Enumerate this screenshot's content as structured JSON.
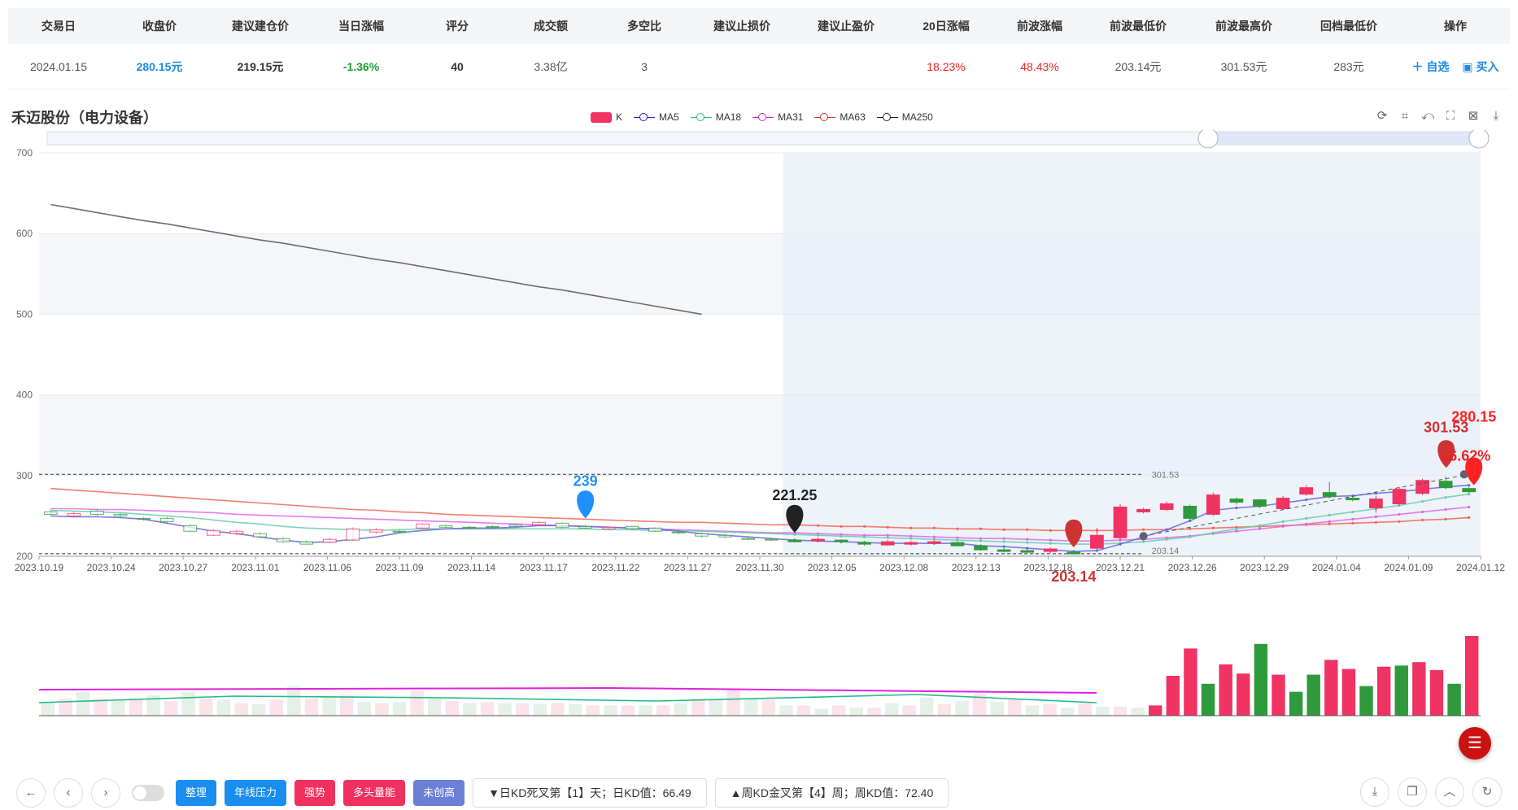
{
  "summary": {
    "headers": [
      "交易日",
      "收盘价",
      "建议建仓价",
      "当日涨幅",
      "评分",
      "成交额",
      "多空比",
      "建议止损价",
      "建议止盈价",
      "20日涨幅",
      "前波涨幅",
      "前波最低价",
      "前波最高价",
      "回档最低价",
      "操作"
    ],
    "row": {
      "date": "2024.01.15",
      "close": "280.15元",
      "entry": "219.15元",
      "change": "-1.36%",
      "score": "40",
      "amount": "3.38亿",
      "ratio": "3",
      "stop_loss": "",
      "take_profit": "",
      "chg20": "18.23%",
      "prev_wave_chg": "48.43%",
      "prev_low": "203.14元",
      "prev_high": "301.53元",
      "pullback_low": "283元"
    },
    "ops": [
      "＋ 自选",
      "▣ 买入"
    ]
  },
  "chart": {
    "title": "禾迈股份（电力设备）",
    "legend": [
      {
        "name": "K",
        "color": "#f03363"
      },
      {
        "name": "MA5",
        "color": "#2222cc"
      },
      {
        "name": "MA18",
        "color": "#22bb88"
      },
      {
        "name": "MA31",
        "color": "#dd22dd"
      },
      {
        "name": "MA63",
        "color": "#dd3333"
      },
      {
        "name": "MA250",
        "color": "#222222"
      }
    ]
  },
  "chart_data": {
    "type": "candlestick",
    "ylim": [
      200,
      700
    ],
    "yticks": [
      200,
      300,
      400,
      500,
      600,
      700
    ],
    "xtick_labels": [
      "2023.10.19",
      "2023.10.24",
      "2023.10.27",
      "2023.11.01",
      "2023.11.06",
      "2023.11.09",
      "2023.11.14",
      "2023.11.17",
      "2023.11.22",
      "2023.11.27",
      "2023.11.30",
      "2023.12.05",
      "2023.12.08",
      "2023.12.13",
      "2023.12.18",
      "2023.12.21",
      "2023.12.26",
      "2023.12.29",
      "2024.01.04",
      "2024.01.09",
      "2024.01.12"
    ],
    "candles": [
      [
        255,
        252,
        258,
        251
      ],
      [
        250,
        253,
        256,
        248
      ],
      [
        256,
        252,
        259,
        250
      ],
      [
        252,
        250,
        254,
        247
      ],
      [
        247,
        246,
        249,
        244
      ],
      [
        247,
        243,
        249,
        240
      ],
      [
        238,
        231,
        240,
        230
      ],
      [
        226,
        232,
        234,
        225
      ],
      [
        228,
        231,
        233,
        226
      ],
      [
        228,
        224,
        230,
        222
      ],
      [
        222,
        218,
        224,
        216
      ],
      [
        218,
        215,
        220,
        214
      ],
      [
        217,
        221,
        223,
        216
      ],
      [
        220,
        234,
        236,
        219
      ],
      [
        230,
        233,
        235,
        228
      ],
      [
        231,
        230,
        233,
        229
      ],
      [
        235,
        240,
        241,
        234
      ],
      [
        238,
        236,
        240,
        235
      ],
      [
        236,
        235,
        238,
        234
      ],
      [
        237,
        236,
        239,
        235
      ],
      [
        239,
        237,
        241,
        236
      ],
      [
        239,
        242,
        243,
        238
      ],
      [
        241,
        236,
        242,
        234
      ],
      [
        237,
        235,
        239,
        234
      ],
      [
        234,
        236,
        237,
        233
      ],
      [
        237,
        234,
        238,
        233
      ],
      [
        235,
        231,
        236,
        230
      ],
      [
        230,
        229,
        232,
        227
      ],
      [
        228,
        225,
        230,
        223
      ],
      [
        226,
        224,
        228,
        222
      ],
      [
        222,
        221,
        224,
        220
      ],
      [
        221,
        220,
        223,
        219
      ],
      [
        220,
        218,
        222,
        217
      ],
      [
        219,
        221,
        223,
        218
      ],
      [
        220,
        218,
        221,
        216
      ],
      [
        217,
        215,
        219,
        213
      ],
      [
        214,
        218,
        220,
        213
      ],
      [
        215,
        217,
        219,
        213
      ],
      [
        216,
        218,
        220,
        215
      ],
      [
        217,
        213,
        218,
        212
      ],
      [
        213,
        208,
        214,
        207
      ],
      [
        208,
        206,
        210,
        205
      ],
      [
        207,
        205,
        209,
        204
      ],
      [
        206,
        209,
        211,
        204
      ],
      [
        205,
        203,
        207,
        202
      ],
      [
        210,
        226,
        235,
        208
      ],
      [
        223,
        261,
        265,
        220
      ],
      [
        255,
        258,
        260,
        253
      ],
      [
        258,
        265,
        268,
        256
      ],
      [
        262,
        247,
        264,
        245
      ],
      [
        252,
        276,
        279,
        250
      ],
      [
        271,
        267,
        273,
        264
      ],
      [
        270,
        262,
        271,
        260
      ],
      [
        259,
        272,
        275,
        257
      ],
      [
        277,
        285,
        288,
        275
      ],
      [
        279,
        274,
        292,
        272
      ],
      [
        272,
        270,
        275,
        268
      ],
      [
        260,
        271,
        275,
        254
      ],
      [
        265,
        283,
        286,
        263
      ],
      [
        278,
        294,
        296,
        276
      ],
      [
        293,
        285,
        299,
        283
      ],
      [
        284,
        280,
        286,
        278
      ]
    ],
    "ma5": [
      250,
      249,
      249,
      248,
      246,
      241,
      236,
      231,
      228,
      224,
      220,
      217,
      218,
      221,
      224,
      229,
      232,
      234,
      235,
      235,
      236,
      238,
      238,
      237,
      236,
      235,
      234,
      231,
      228,
      226,
      224,
      222,
      220,
      219,
      218,
      217,
      216,
      216,
      216,
      216,
      213,
      212,
      210,
      208,
      206,
      207,
      215,
      224,
      233,
      244,
      257,
      260,
      262,
      266,
      270,
      274,
      275,
      278,
      280,
      283,
      286,
      288
    ],
    "ma18": [
      257,
      256,
      255,
      254,
      252,
      250,
      248,
      245,
      242,
      240,
      237,
      235,
      234,
      233,
      232,
      233,
      234,
      234,
      234,
      234,
      234,
      234,
      234,
      234,
      233,
      233,
      232,
      232,
      231,
      230,
      229,
      228,
      227,
      226,
      225,
      224,
      223,
      222,
      221,
      220,
      219,
      218,
      217,
      216,
      215,
      215,
      216,
      218,
      221,
      224,
      229,
      234,
      238,
      243,
      247,
      251,
      255,
      259,
      263,
      268,
      273,
      277
    ],
    "ma31": [
      259,
      259,
      258,
      258,
      257,
      256,
      255,
      254,
      252,
      251,
      250,
      249,
      248,
      247,
      246,
      245,
      244,
      243,
      242,
      241,
      240,
      239,
      238,
      237,
      236,
      235,
      234,
      233,
      232,
      231,
      230,
      229,
      229,
      228,
      227,
      226,
      226,
      225,
      224,
      223,
      222,
      222,
      221,
      220,
      219,
      219,
      220,
      221,
      223,
      225,
      228,
      231,
      234,
      237,
      240,
      243,
      246,
      249,
      252,
      255,
      258,
      261
    ],
    "ma63": [
      284,
      282,
      280,
      278,
      276,
      274,
      272,
      270,
      268,
      266,
      264,
      262,
      260,
      258,
      257,
      255,
      254,
      252,
      251,
      250,
      249,
      248,
      247,
      246,
      245,
      244,
      243,
      242,
      242,
      241,
      240,
      239,
      239,
      238,
      237,
      237,
      236,
      235,
      235,
      234,
      234,
      233,
      233,
      232,
      232,
      232,
      232,
      233,
      233,
      234,
      235,
      236,
      237,
      238,
      239,
      240,
      241,
      242,
      243,
      245,
      246,
      248
    ],
    "ma250": [
      636,
      631,
      626,
      621,
      616,
      612,
      607,
      602,
      597,
      592,
      588,
      583,
      578,
      573,
      568,
      564,
      559,
      554,
      549,
      544,
      539,
      534,
      530,
      525,
      520,
      515,
      510,
      505,
      500
    ],
    "ma250_start_index": 0,
    "markers": [
      {
        "label": "239",
        "index": 23,
        "value": 239,
        "color": "#1e90ff"
      },
      {
        "label": "221.25",
        "index": 32,
        "value": 221.25,
        "color": "#222222"
      },
      {
        "label": "203.14",
        "index": 44,
        "value": 203.14,
        "color": "#cc3333"
      },
      {
        "label": "301.53",
        "index": 61,
        "value": 301.53,
        "color": "#cc3333"
      },
      {
        "label": "280.15",
        "index": 61,
        "value": 280.15,
        "color": "#ff2222"
      }
    ],
    "pct_annotation": "36.62%",
    "hlines": [
      {
        "value": 301.53,
        "label": "301.53"
      },
      {
        "value": 203.14,
        "label": "203.14"
      }
    ],
    "volume": [
      24,
      30,
      42,
      30,
      28,
      30,
      36,
      26,
      42,
      30,
      28,
      22,
      20,
      28,
      52,
      30,
      34,
      36,
      24,
      22,
      24,
      44,
      30,
      26,
      22,
      24,
      22,
      22,
      20,
      22,
      20,
      18,
      18,
      18,
      18,
      18,
      22,
      30,
      28,
      48,
      30,
      28,
      18,
      18,
      12,
      18,
      14,
      14,
      22,
      18,
      32,
      20,
      26,
      38,
      24,
      28,
      18,
      20,
      14,
      22,
      16,
      16,
      14,
      18,
      70,
      118,
      56,
      90,
      74,
      126,
      72,
      42,
      72,
      98,
      82,
      52,
      86,
      88,
      94,
      80,
      56,
      140
    ],
    "volume_max": 140,
    "zoom_window": [
      0.5,
      1.0
    ]
  },
  "controls": {
    "tags": [
      {
        "label": "整理",
        "color": "blue"
      },
      {
        "label": "年线压力",
        "color": "blue"
      },
      {
        "label": "强势",
        "color": "red"
      },
      {
        "label": "多头量能",
        "color": "red"
      },
      {
        "label": "未创高",
        "color": "purple"
      }
    ],
    "info_day": "▼日KD死叉第【1】天；日KD值：66.49",
    "info_week": "▲周KD金叉第【4】周；周KD值：72.40"
  }
}
